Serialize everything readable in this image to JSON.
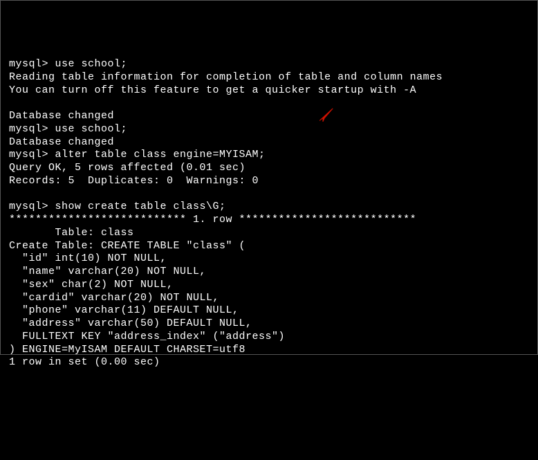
{
  "terminal": {
    "lines": [
      "mysql> use school;",
      "Reading table information for completion of table and column names",
      "You can turn off this feature to get a quicker startup with -A",
      "",
      "Database changed",
      "mysql> use school;",
      "Database changed",
      "mysql> alter table class engine=MYISAM;",
      "Query OK, 5 rows affected (0.01 sec)",
      "Records: 5  Duplicates: 0  Warnings: 0",
      "",
      "mysql> show create table class\\G;",
      "*************************** 1. row ***************************",
      "       Table: class",
      "Create Table: CREATE TABLE \"class\" (",
      "  \"id\" int(10) NOT NULL,",
      "  \"name\" varchar(20) NOT NULL,",
      "  \"sex\" char(2) NOT NULL,",
      "  \"cardid\" varchar(20) NOT NULL,",
      "  \"phone\" varchar(11) DEFAULT NULL,",
      "  \"address\" varchar(50) DEFAULT NULL,",
      "  FULLTEXT KEY \"address_index\" (\"address\")",
      ") ENGINE=MyISAM DEFAULT CHARSET=utf8",
      "1 row in set (0.00 sec)"
    ]
  },
  "annotation": {
    "arrow_glyph": "➤"
  }
}
